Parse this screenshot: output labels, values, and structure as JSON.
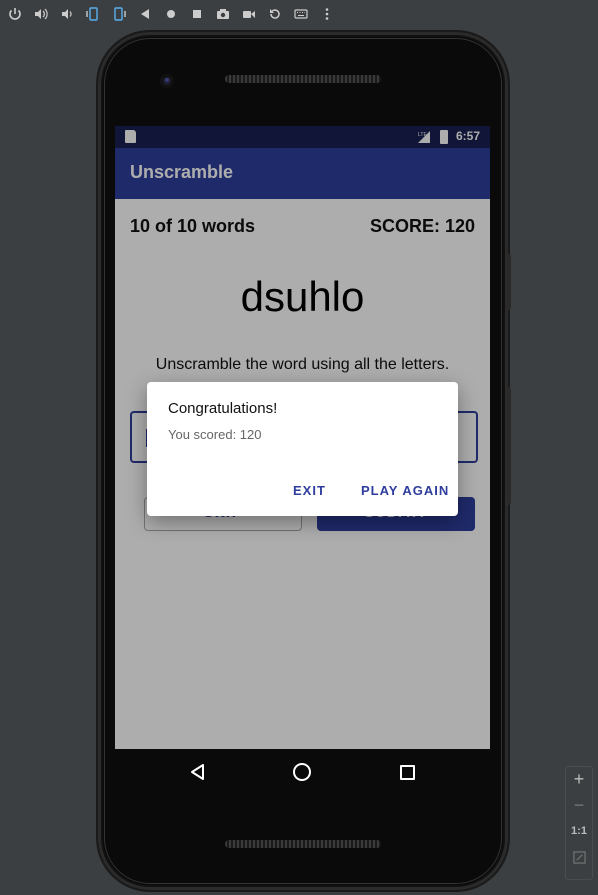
{
  "emulator_toolbar": {
    "icons": [
      "power-icon",
      "volume-up-icon",
      "volume-down-icon",
      "rotate-left-icon",
      "rotate-right-icon",
      "back-icon",
      "home-icon",
      "overview-icon",
      "camera-icon",
      "video-icon",
      "replay-icon",
      "keyboard-icon",
      "more-icon"
    ]
  },
  "status_bar": {
    "network": "LTE",
    "time": "6:57"
  },
  "app_bar": {
    "title": "Unscramble"
  },
  "game": {
    "word_count": "10 of 10 words",
    "score": "SCORE: 120",
    "scrambled_word": "dsuhlo",
    "instructions": "Unscramble the word using all the letters.",
    "skip_label": "SKIP",
    "submit_label": "SUBMIT"
  },
  "dialog": {
    "title": "Congratulations!",
    "message": "You scored: 120",
    "exit_label": "EXIT",
    "play_again_label": "PLAY AGAIN"
  },
  "zoom_panel": {
    "zoom_in": "+",
    "zoom_out": "−",
    "actual_size": "1:1"
  },
  "colors": {
    "primary": "#2f3e9e",
    "status_bar": "#1a2052",
    "emulator_bg": "#3c3f41"
  }
}
